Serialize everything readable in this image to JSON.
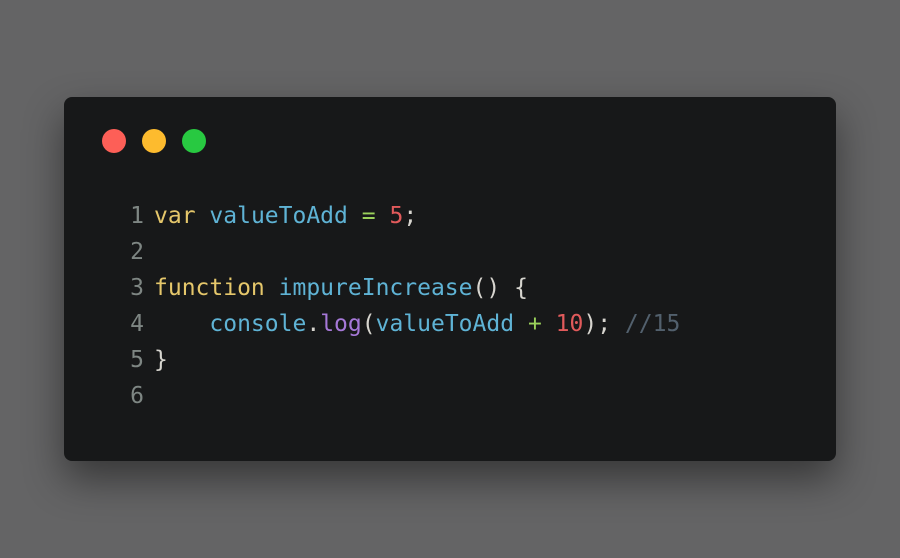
{
  "window": {
    "controls": [
      {
        "name": "close",
        "color": "#fd5f57"
      },
      {
        "name": "minimize",
        "color": "#fdbb2e"
      },
      {
        "name": "maximize",
        "color": "#28c941"
      }
    ]
  },
  "code": {
    "lines": [
      {
        "number": "1",
        "tokens": [
          "var",
          " ",
          "valueToAdd",
          " ",
          "=",
          " ",
          "5",
          ";"
        ]
      },
      {
        "number": "2",
        "tokens": []
      },
      {
        "number": "3",
        "tokens": [
          "function",
          " ",
          "impureIncrease",
          "()",
          " ",
          "{"
        ]
      },
      {
        "number": "4",
        "tokens": [
          "    ",
          "console",
          ".",
          "log",
          "(",
          "valueToAdd",
          " ",
          "+",
          " ",
          "10",
          ");",
          " ",
          "//15"
        ]
      },
      {
        "number": "5",
        "tokens": [
          "}"
        ]
      },
      {
        "number": "6",
        "tokens": []
      }
    ]
  }
}
